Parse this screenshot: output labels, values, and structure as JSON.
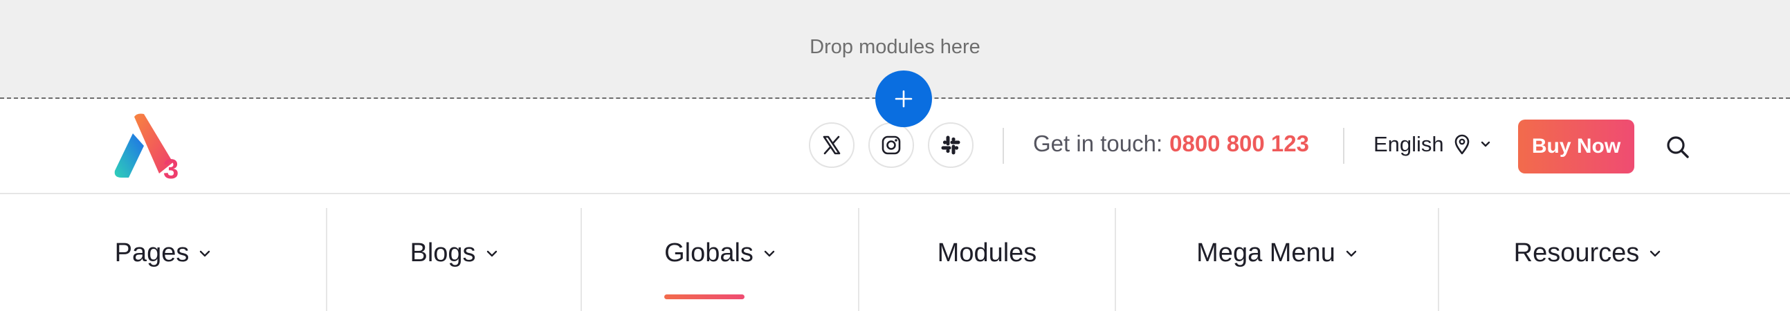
{
  "dropzone": {
    "text": "Drop modules here"
  },
  "add_button": {
    "icon": "plus-icon"
  },
  "header": {
    "logo": {
      "icon": "a3-logo-icon"
    },
    "social": [
      {
        "name": "x-icon"
      },
      {
        "name": "instagram-icon"
      },
      {
        "name": "slack-icon"
      }
    ],
    "contact": {
      "label": "Get in touch:",
      "phone": "0800 800 123"
    },
    "language": {
      "label": "English",
      "icons": [
        "location-pin-icon",
        "chevron-down-icon"
      ]
    },
    "buy_button": "Buy Now",
    "search": {
      "icon": "search-icon"
    }
  },
  "nav": {
    "items": [
      {
        "label": "Pages",
        "has_dropdown": true
      },
      {
        "label": "Blogs",
        "has_dropdown": true
      },
      {
        "label": "Globals",
        "has_dropdown": true,
        "active": true
      },
      {
        "label": "Modules",
        "has_dropdown": false
      },
      {
        "label": "Mega Menu",
        "has_dropdown": true
      },
      {
        "label": "Resources",
        "has_dropdown": true
      }
    ]
  },
  "colors": {
    "accent_start": "#f26b4c",
    "accent_end": "#ef4c72",
    "phone": "#ef5a5a",
    "add_button": "#0a6ee0"
  }
}
